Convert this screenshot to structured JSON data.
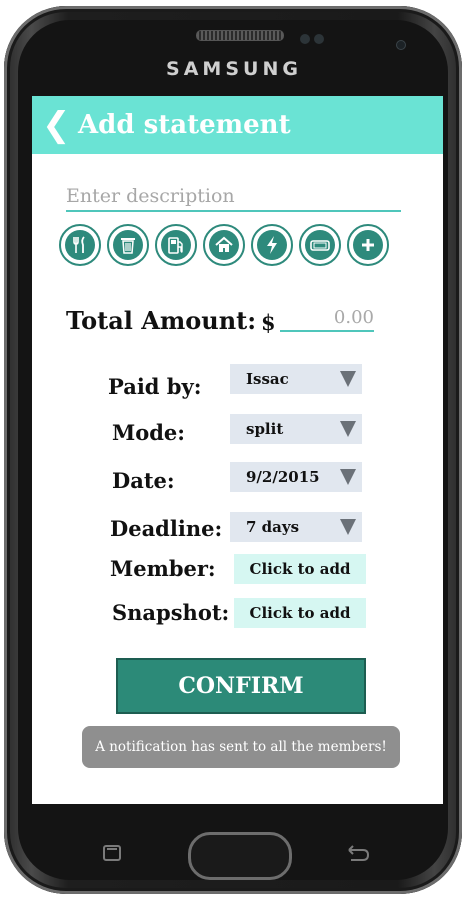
{
  "device": {
    "brand": "SAMSUNG"
  },
  "header": {
    "back_icon": "chevron-left-icon",
    "title": "Add statement"
  },
  "description": {
    "placeholder": "Enter description"
  },
  "categories": [
    {
      "name": "food",
      "icon": "fork-knife-icon"
    },
    {
      "name": "trash",
      "icon": "trash-icon"
    },
    {
      "name": "fuel",
      "icon": "gas-pump-icon"
    },
    {
      "name": "home",
      "icon": "house-icon"
    },
    {
      "name": "electricity",
      "icon": "lightning-icon"
    },
    {
      "name": "ticket",
      "icon": "ticket-icon"
    },
    {
      "name": "add",
      "icon": "plus-icon"
    }
  ],
  "amount": {
    "label": "Total Amount:",
    "currency": "$",
    "placeholder": "0.00"
  },
  "fields": {
    "paid_by": {
      "label": "Paid by:",
      "value": "Issac"
    },
    "mode": {
      "label": "Mode:",
      "value": "split"
    },
    "date": {
      "label": "Date:",
      "value": "9/2/2015"
    },
    "deadline": {
      "label": "Deadline:",
      "value": "7 days"
    },
    "member": {
      "label": "Member:",
      "action": "Click to add"
    },
    "snapshot": {
      "label": "Snapshot:",
      "action": "Click to add"
    }
  },
  "confirm_label": "CONFIRM",
  "notification": "A notification has sent to all the members!",
  "colors": {
    "appbar": "#6ae3d4",
    "accent": "#2c8a78",
    "select_bg": "#e1e7ef",
    "add_bg": "#d6f7f2"
  }
}
